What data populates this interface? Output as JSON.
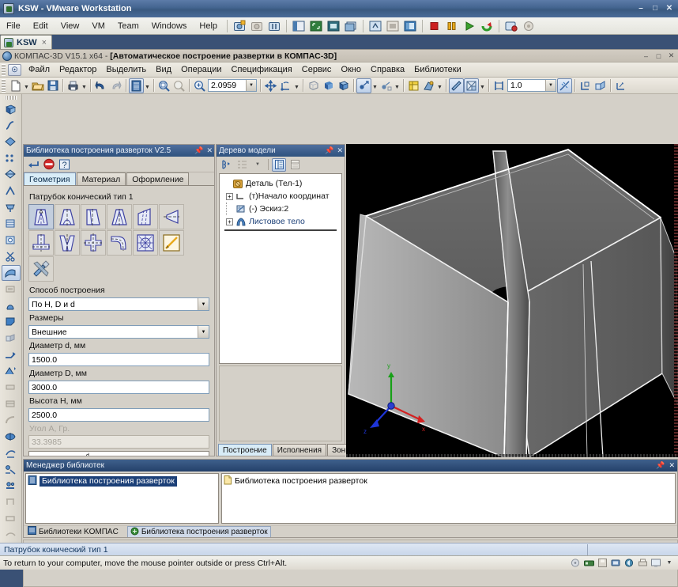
{
  "vmware": {
    "title": "KSW - VMware Workstation",
    "app_icon": "vmware-icon",
    "window_buttons": [
      "minimize-icon",
      "restore-icon",
      "close-icon"
    ],
    "menu": [
      "File",
      "Edit",
      "View",
      "VM",
      "Team",
      "Windows",
      "Help"
    ],
    "toolbar_icons": [
      "snapshot-take-icon",
      "snapshot-revert-icon",
      "snapshot-manager-icon",
      "show-sidebar-icon",
      "fullscreen-icon",
      "unity-icon",
      "quick-switch-icon",
      "console-view-icon",
      "thumbnail-view-icon",
      "fit-guest-icon",
      "power-off-icon",
      "suspend-icon",
      "power-on-icon",
      "reset-icon",
      "vm-settings-icon",
      "preferences-icon"
    ],
    "tab": {
      "label": "KSW",
      "icon": "vm-tab-icon",
      "close": "×"
    },
    "status": "To return to your computer, move the mouse pointer outside or press Ctrl+Alt.",
    "tray_icons": [
      "disk-icon",
      "network-icon",
      "floppy-icon",
      "usb-icon",
      "sound-icon",
      "printer-icon",
      "display-icon"
    ]
  },
  "kompas": {
    "title_prefix": "КОМПАС-3D V15.1 x64 - ",
    "title_doc": "[Автоматическое построение развертки в КОМПАС-3D]",
    "window_buttons": [
      "minimize-icon",
      "restore-icon",
      "close-icon"
    ],
    "menu": [
      "Файл",
      "Редактор",
      "Выделить",
      "Вид",
      "Операции",
      "Спецификация",
      "Сервис",
      "Окно",
      "Справка",
      "Библиотеки"
    ],
    "toolbar": {
      "new_doc": "new-document-icon",
      "open": "open-folder-icon",
      "save": "save-icon",
      "print": "print-icon",
      "undo": "undo-arrow-icon",
      "redo": "redo-arrow-icon",
      "manager": "library-manager-icon",
      "zoom_window": "zoom-window-icon",
      "zoom_prev": "zoom-previous-icon",
      "zoom_scale": "zoom-scale-icon",
      "zoom_value": "2.0959",
      "pan": "pan-move-icon",
      "rotate": "rotate-icon",
      "wire_iso": "wireframe-icon",
      "shade_noedge": "shaded-icon",
      "shade_edge": "shaded-with-edges-icon",
      "light_source": "light-source-icon",
      "light_add": "add-light-icon",
      "cut_model": "section-icon",
      "perspective": "perspective-icon",
      "sketch": "sketch-icon",
      "hide_all": "hide-all-icon",
      "thickness": "sheet-thickness-icon",
      "thickness_value": "1.0",
      "snap": "snap-icon",
      "bend_param": "bend-params-icon",
      "unfold": "unfold-icon",
      "flat_pattern": "flat-pattern-icon"
    },
    "left_toolbar_icons": [
      "sheet-body-icon",
      "bend-line-icon",
      "bend-icon",
      "bend-along-line-icon",
      "ruled-bend-icon",
      "closed-corner-icon",
      "stamp-icon",
      "louver-icon",
      "hole-icon",
      "cut-icon",
      "sheet-part-icon",
      "sheet-body-2-icon",
      "rib-icon",
      "fold-icon",
      "unfold-2-icon",
      "unbend-icon",
      "bend-sequence-icon",
      "plate-icon",
      "flange-icon",
      "arc-flange-icon",
      "combine-icon",
      "split-icon",
      "parameters-icon",
      "properties-icon",
      "jog-icon",
      "cutout-icon",
      "array-icon"
    ],
    "status_text": "Патрубок конический тип 1"
  },
  "library_panel": {
    "caption": "Библиотека построения разверток V2.5",
    "caption_buttons": [
      "pin-icon",
      "close-icon"
    ],
    "toolbar_icons": [
      "apply-enter-icon",
      "stop-icon",
      "help-icon"
    ],
    "tabs": [
      {
        "label": "Геометрия",
        "active": true
      },
      {
        "label": "Материал",
        "active": false
      },
      {
        "label": "Оформление",
        "active": false
      }
    ],
    "shape_group_label": "Патрубок конический тип 1",
    "shape_icons": [
      {
        "name": "cone-nozzle-type1-icon",
        "selected": true
      },
      {
        "name": "cone-nozzle-type2-icon",
        "selected": false
      },
      {
        "name": "cone-nozzle-type3-icon",
        "selected": false
      },
      {
        "name": "cone-nozzle-type4-icon",
        "selected": false
      },
      {
        "name": "oblique-cone-icon",
        "selected": false
      },
      {
        "name": "cone-side-view-icon",
        "selected": false
      },
      {
        "name": "tee-branch-icon",
        "selected": false
      },
      {
        "name": "pants-transition-icon",
        "selected": false
      },
      {
        "name": "cross-branch-icon",
        "selected": false
      },
      {
        "name": "elbow-bend-icon",
        "selected": false
      },
      {
        "name": "spiral-unfold-icon",
        "selected": false
      },
      {
        "name": "draw-pencil-icon",
        "selected": false
      },
      {
        "name": "settings-tools-icon",
        "selected": false
      }
    ],
    "fields": [
      {
        "label": "Способ построения",
        "type": "select",
        "value": "По H, D и d",
        "disabled": false
      },
      {
        "label": "Размеры",
        "type": "select",
        "value": "Внешние",
        "disabled": false
      },
      {
        "label": "Диаметр d, мм",
        "type": "input",
        "value": "1500.0",
        "disabled": false
      },
      {
        "label": "Диаметр D, мм",
        "type": "input",
        "value": "3000.0",
        "disabled": false
      },
      {
        "label": "Высота H, мм",
        "type": "input",
        "value": "2500.0",
        "disabled": false
      },
      {
        "label": "Угол A, Гр.",
        "type": "input",
        "value": "33.3985",
        "disabled": true
      }
    ],
    "preview_dim_label": "d"
  },
  "tree_panel": {
    "caption": "Дерево модели",
    "caption_buttons": [
      "pin-icon",
      "close-icon"
    ],
    "toolbar_icons": [
      "tree-show-icon",
      "tree-structure-icon",
      "tree-list-icon",
      "tree-panel-icon"
    ],
    "nodes": [
      {
        "label": "Деталь (Тел-1)",
        "icon": "part-icon",
        "expander": "none",
        "level": 0
      },
      {
        "label": "(т)Начало координат",
        "icon": "origin-icon",
        "expander": "+",
        "level": 1
      },
      {
        "label": "(-) Эскиз:2",
        "icon": "sketch-node-icon",
        "expander": "none",
        "level": 1
      },
      {
        "label": "Листовое тело",
        "icon": "sheet-body-node-icon",
        "expander": "+",
        "level": 1
      }
    ],
    "tabs": [
      {
        "label": "Построение",
        "active": true
      },
      {
        "label": "Исполнения",
        "active": false
      },
      {
        "label": "Зоны",
        "active": false
      }
    ]
  },
  "viewport": {
    "background": "#000000",
    "model_description": "conical transition nozzle (frustum) sheet-metal body, shaded with edges",
    "axis_labels": {
      "x": "x",
      "y": "y",
      "z": "z"
    },
    "axis_colors": {
      "x": "#d42020",
      "y": "#17a017",
      "z": "#1e35d8"
    }
  },
  "library_manager": {
    "caption": "Менеджер библиотек",
    "caption_buttons": [
      "pin-icon",
      "close-icon"
    ],
    "left_tree": [
      {
        "label": "Библиотека построения разверток",
        "icon": "library-list-icon",
        "selected": true
      }
    ],
    "right_list": [
      {
        "label": "Библиотека построения разверток",
        "icon": "folder-icon"
      }
    ],
    "tabs": [
      {
        "label": "Библиотеки KOMПAC",
        "icon": "kompas-libs-icon",
        "active": false
      },
      {
        "label": "Библиотека построения разверток",
        "icon": "unfold-lib-icon",
        "active": true
      }
    ]
  },
  "colors": {
    "vmware_title_blue": "#43648f",
    "panel_caption_blue": "#2f527e",
    "window_face": "#d4d0c8",
    "tab_active": "#d8ecf7",
    "input_border": "#7f9db9",
    "status_bar": "#c8d6ea",
    "selection": "#1b3f77"
  }
}
